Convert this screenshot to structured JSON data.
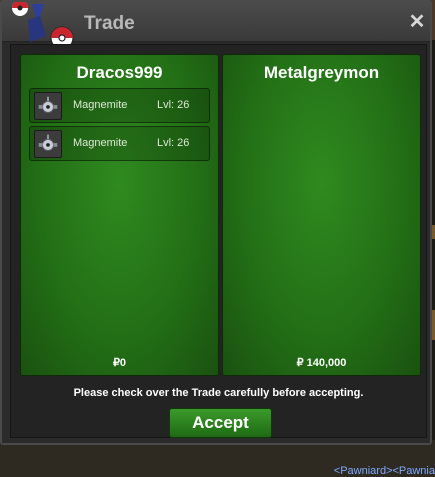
{
  "window": {
    "title": "Trade",
    "close_label": "✕"
  },
  "left": {
    "trainer": "Dracos999",
    "items": [
      {
        "name": "Magnemite",
        "level": "Lvl: 26"
      },
      {
        "name": "Magnemite",
        "level": "Lvl: 26"
      }
    ],
    "money": "₽0"
  },
  "right": {
    "trainer": "Metalgreymon",
    "items": [],
    "money": "₽ 140,000"
  },
  "notice": "Please check over the Trade carefully before accepting.",
  "accept_label": "Accept",
  "background": {
    "footer_text": "<Pawniard><Pawnia"
  }
}
